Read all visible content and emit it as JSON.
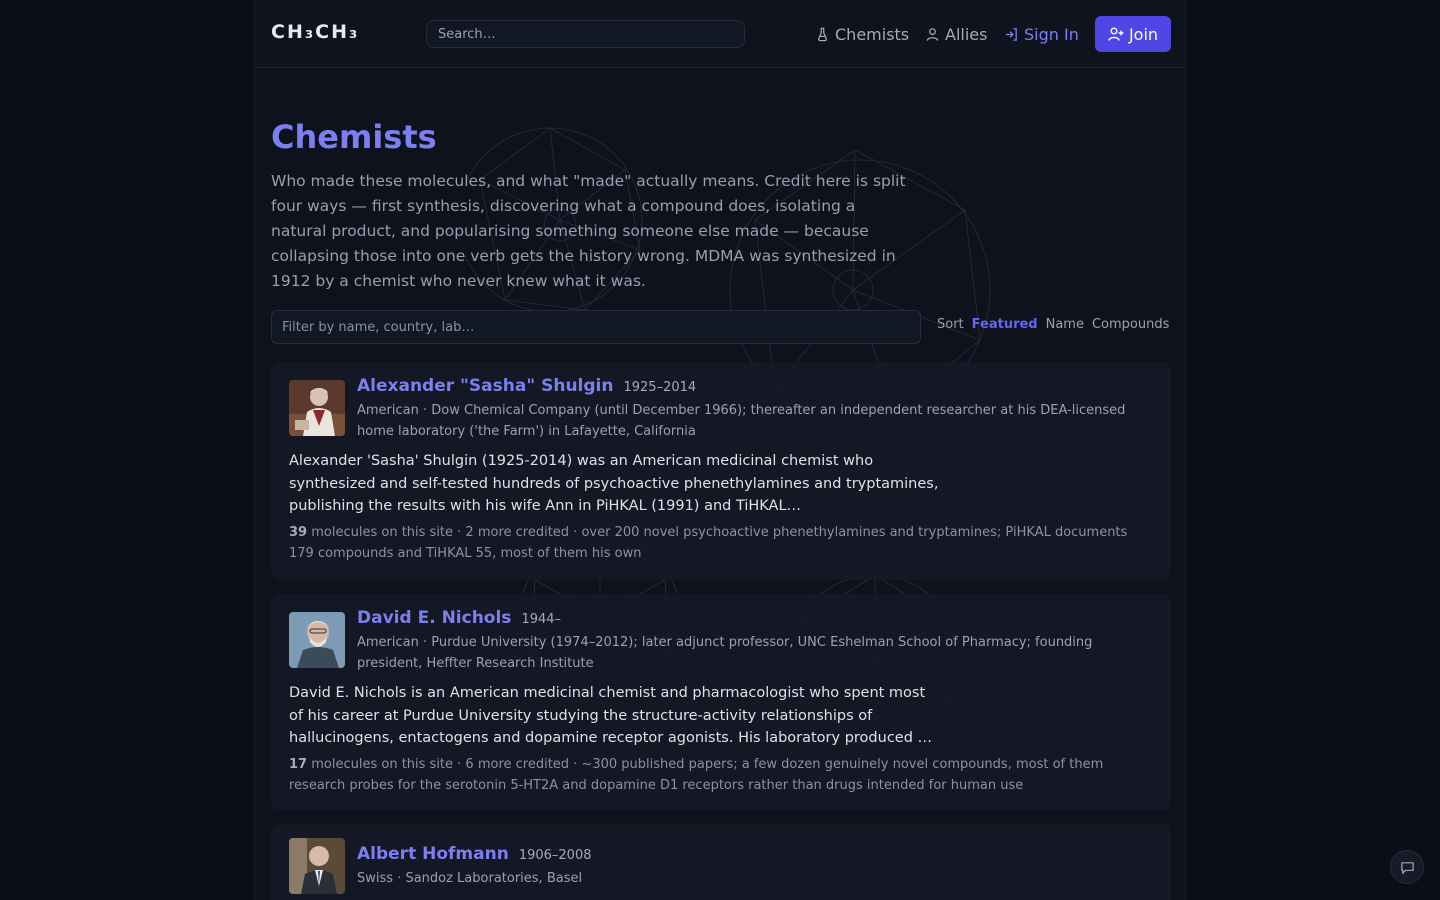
{
  "header": {
    "logo": "CH₃CH₃",
    "search_placeholder": "Search…",
    "nav": {
      "chemists": "Chemists",
      "allies": "Allies",
      "sign_in": "Sign In",
      "join": "Join"
    }
  },
  "hero": {
    "title": "Chemists",
    "intro": "Who made these molecules, and what \"made\" actually means. Credit here is split four ways — first synthesis, discovering what a compound does, isolating a natural product, and popularising something someone else made — because collapsing those into one verb gets the history wrong. MDMA was synthesized in 1912 by a chemist who never knew what it was."
  },
  "filter": {
    "placeholder": "Filter by name, country, lab…",
    "sort_label": "Sort",
    "sort_options": [
      "Featured",
      "Name",
      "Compounds"
    ],
    "active_sort": "Featured"
  },
  "chemists": [
    {
      "name": "Alexander \"Sasha\" Shulgin",
      "dates": "1925–2014",
      "affiliation": "American · Dow Chemical Company (until December 1966); thereafter an independent researcher at his DEA-licensed home laboratory ('the Farm') in Lafayette, California",
      "bio": "Alexander 'Sasha' Shulgin (1925-2014) was an American medicinal chemist who synthesized and self-tested hundreds of psychoactive phenethylamines and tryptamines, publishing the results with his wife Ann in PiHKAL (1991) and TiHKAL…",
      "molecule_count": "39",
      "stats_rest": "molecules on this site · 2 more credited · over 200 novel psychoactive phenethylamines and tryptamines; PiHKAL documents 179 compounds and TiHKAL 55, most of them his own"
    },
    {
      "name": "David E. Nichols",
      "dates": "1944–",
      "affiliation": "American · Purdue University (1974–2012); later adjunct professor, UNC Eshelman School of Pharmacy; founding president, Heffter Research Institute",
      "bio": "David E. Nichols is an American medicinal chemist and pharmacologist who spent most of his career at Purdue University studying the structure-activity relationships of hallucinogens, entactogens and dopamine receptor agonists. His laboratory produced …",
      "molecule_count": "17",
      "stats_rest": "molecules on this site · 6 more credited · ~300 published papers; a few dozen genuinely novel compounds, most of them research probes for the serotonin 5-HT2A and dopamine D1 receptors rather than drugs intended for human use"
    },
    {
      "name": "Albert Hofmann",
      "dates": "1906–2008",
      "affiliation": "Swiss · Sandoz Laboratories, Basel"
    }
  ]
}
